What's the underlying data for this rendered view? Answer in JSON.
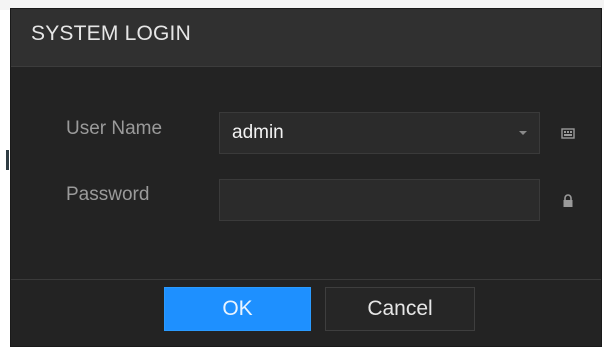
{
  "dialog": {
    "title": "SYSTEM LOGIN"
  },
  "form": {
    "username_label": "User Name",
    "username_value": "admin",
    "password_label": "Password",
    "password_value": ""
  },
  "icons": {
    "username_field_icon": "keyboard-icon",
    "password_field_icon": "lock-icon"
  },
  "buttons": {
    "ok_label": "OK",
    "cancel_label": "Cancel"
  },
  "colors": {
    "dialog_background": "#232323",
    "titlebar_background": "#303030",
    "ok_button": "#1e90ff"
  }
}
